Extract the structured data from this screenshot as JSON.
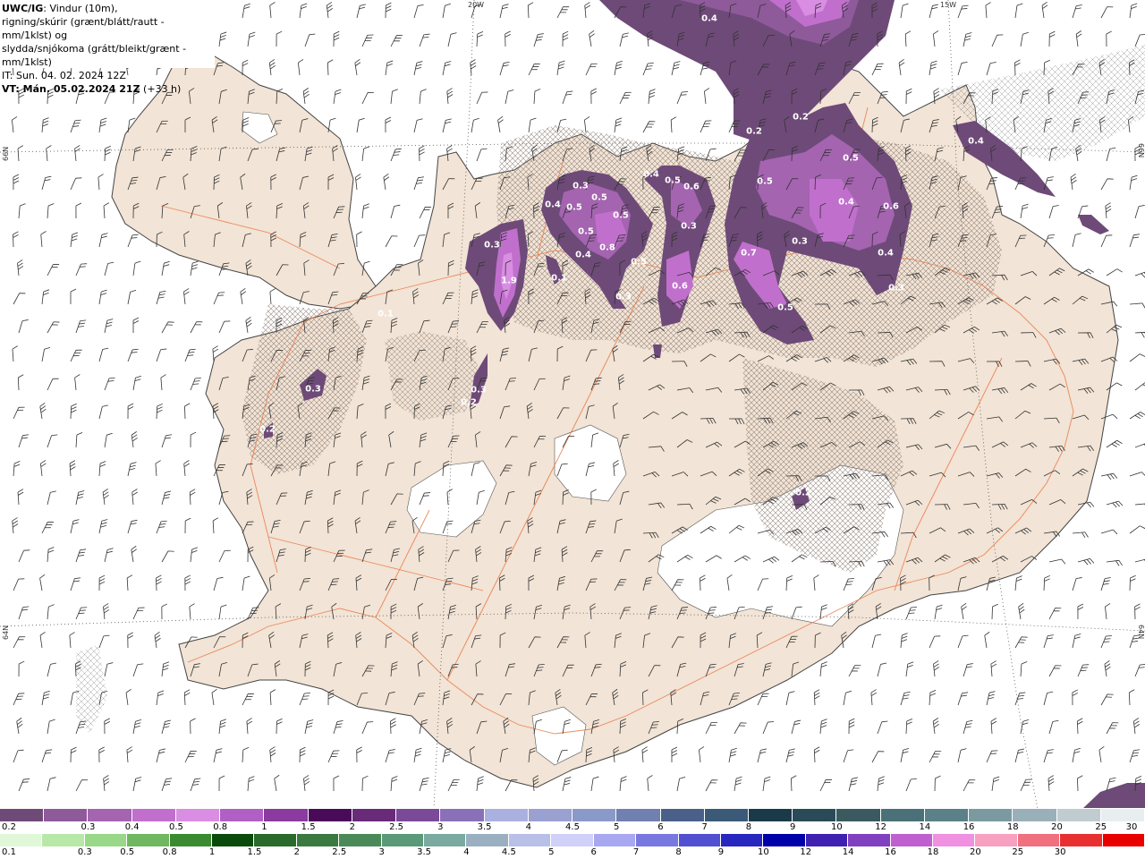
{
  "info": {
    "title_bold": "UWC/IG",
    "title_rest": ": Vindur (10m),",
    "line2": "rigning/skúrir (grænt/blátt/rautt - mm/1klst) og",
    "line3": "slydda/snjókoma (grátt/bleikt/grænt - mm/1klst)",
    "line4": "IT: Sun. 04. 02. 2024 12Z",
    "line5_bold": "VT: Mán. 05.02.2024 21Z",
    "line5_rest": " (+33 h)"
  },
  "grid_labels": {
    "top_left": "20W",
    "top_right": "15W",
    "left_upper": "66N",
    "left_lower": "64N",
    "right_upper": "66N",
    "right_lower": "64N"
  },
  "value_labels": [
    {
      "text": "0.4"
    },
    {
      "text": "0.2"
    },
    {
      "text": "0.2"
    },
    {
      "text": "0.4"
    },
    {
      "text": "0.5"
    },
    {
      "text": "0.5"
    },
    {
      "text": "0.4"
    },
    {
      "text": "0.6"
    },
    {
      "text": "0.5"
    },
    {
      "text": "0.3"
    },
    {
      "text": "0.4"
    },
    {
      "text": "0.3"
    },
    {
      "text": "0.5"
    },
    {
      "text": "0.4"
    },
    {
      "text": "0.5"
    },
    {
      "text": "0.4"
    },
    {
      "text": "0.6"
    },
    {
      "text": "0.3"
    },
    {
      "text": "0.5"
    },
    {
      "text": "0.5"
    },
    {
      "text": "0.8"
    },
    {
      "text": "0.3"
    },
    {
      "text": "0.7"
    },
    {
      "text": "0.5"
    },
    {
      "text": "0.6"
    },
    {
      "text": "0.3"
    },
    {
      "text": "0.5"
    },
    {
      "text": "0.3"
    },
    {
      "text": "0.4"
    },
    {
      "text": "0.3"
    },
    {
      "text": "1.9"
    },
    {
      "text": "0.1"
    },
    {
      "text": "0.3"
    },
    {
      "text": "0.2"
    },
    {
      "text": "0.2"
    },
    {
      "text": "0.1"
    },
    {
      "text": "0.2"
    }
  ],
  "legend": {
    "top_row": {
      "colors": [
        "#6e4a78",
        "#8e5a9a",
        "#a464b0",
        "#c070cc",
        "#d98ee3",
        "#b060c4",
        "#8a3aa0",
        "#4a0a5a",
        "#6a2a7a",
        "#7a4a98",
        "#8a70b8",
        "#aab0e0",
        "#9aa0d0",
        "#8a9ac8",
        "#7080b0",
        "#4a6088",
        "#3a5a78",
        "#1a3a4a",
        "#2a4a58",
        "#3a5a60",
        "#4a7078",
        "#5a8088",
        "#7a9aa0",
        "#9ab0b8",
        "#c0ccd0",
        "#e8eef0"
      ],
      "ticks": [
        "0.2",
        "0.3",
        "0.4",
        "0.5",
        "0.8",
        "1",
        "1.5",
        "2",
        "2.5",
        "3",
        "3.5",
        "4",
        "4.5",
        "5",
        "6",
        "7",
        "8",
        "9",
        "10",
        "12",
        "14",
        "16",
        "18",
        "20",
        "25",
        "30"
      ]
    },
    "bottom_row": {
      "colors": [
        "#e0f8d8",
        "#b8e8a8",
        "#98d888",
        "#70b860",
        "#3a8a30",
        "#0a4a0a",
        "#2a6a2a",
        "#3a7a40",
        "#4a8a58",
        "#5a9a78",
        "#7aaaa0",
        "#9ab0c0",
        "#b8c0e8",
        "#d0d0f8",
        "#a8a8f0",
        "#7878e0",
        "#5050d0",
        "#2828c0",
        "#0000a8",
        "#4020b0",
        "#8040c0",
        "#c060d0",
        "#f090e0",
        "#f8a0c0",
        "#f07080",
        "#e83030",
        "#e80000"
      ],
      "ticks": [
        "0.1",
        "0.3",
        "0.5",
        "0.8",
        "1",
        "1.5",
        "2",
        "2.5",
        "3",
        "3.5",
        "4",
        "4.5",
        "5",
        "6",
        "7",
        "8",
        "9",
        "10",
        "12",
        "14",
        "16",
        "18",
        "20",
        "25",
        "30"
      ]
    }
  }
}
